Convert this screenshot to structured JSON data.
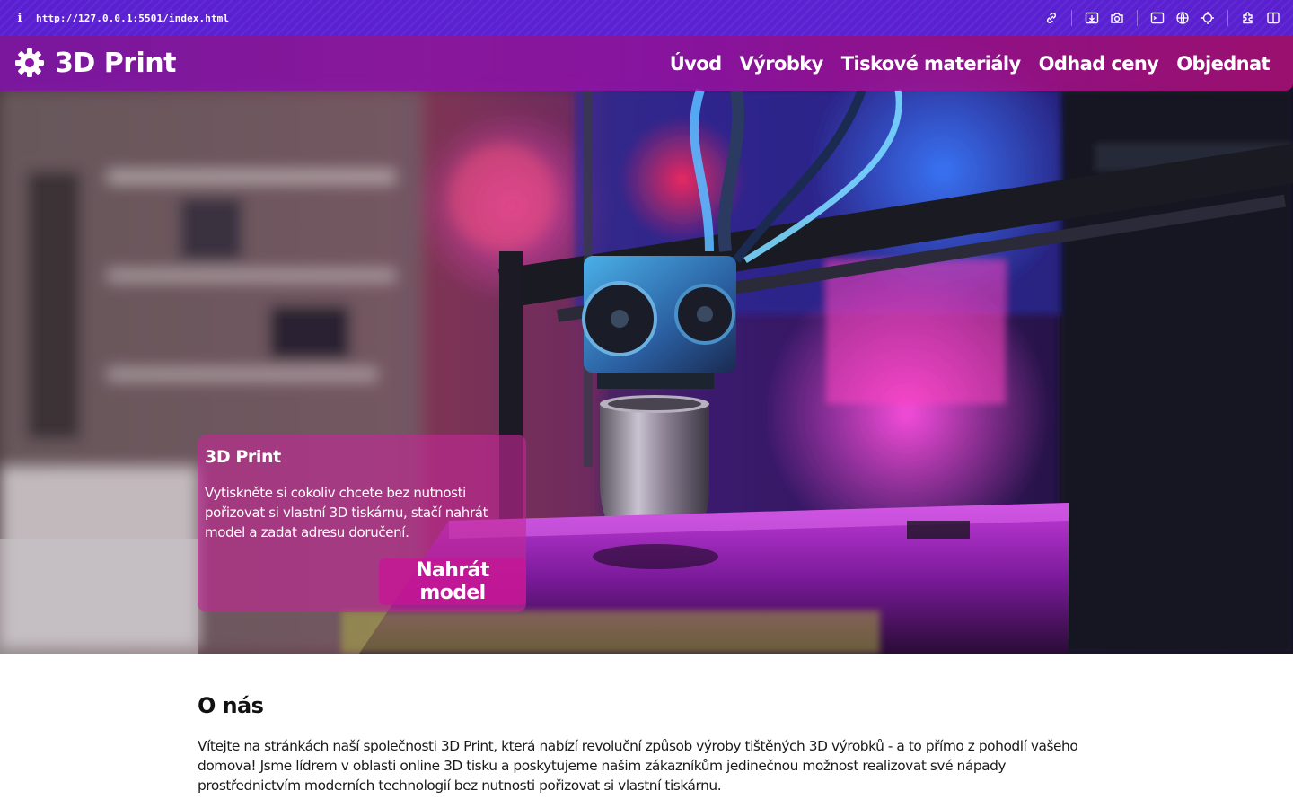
{
  "browser": {
    "info_glyph": "i",
    "url": "http://127.0.0.1:5501/index.html",
    "tools": [
      "link-icon",
      "download-icon",
      "camera-icon",
      "terminal-icon",
      "globe-icon",
      "crosshair-icon",
      "extension-icon",
      "sidebar-icon"
    ]
  },
  "nav": {
    "logo_text": "3D Print",
    "links": [
      "Úvod",
      "Výrobky",
      "Tiskové materiály",
      "Odhad ceny",
      "Objednat"
    ]
  },
  "hero": {
    "image": "3d-printer-neon-photo",
    "card": {
      "title": "3D Print",
      "text": "Vytiskněte si cokoliv chcete bez nutnosti pořizovat si vlastní 3D tiskárnu, stačí nahrát model a zadat adresu doručení.",
      "button": "Nahrát model"
    }
  },
  "about": {
    "heading": "O nás",
    "text": "Vítejte na stránkách naší společnosti 3D Print, která nabízí revoluční způsob výroby tištěných 3D výrobků - a to přímo z pohodlí vašeho domova! Jsme lídrem v oblasti online 3D tisku a poskytujeme našim zákazníkům jedinečnou možnost realizovat své nápady prostřednictvím moderních technologií bez nutnosti pořizovat si vlastní tiskárnu."
  },
  "colors": {
    "browser_bar": "#5a1fd1",
    "nav_bg": "#8a12aa",
    "card_bg": "#c42896",
    "button_bg": "#c81496"
  }
}
